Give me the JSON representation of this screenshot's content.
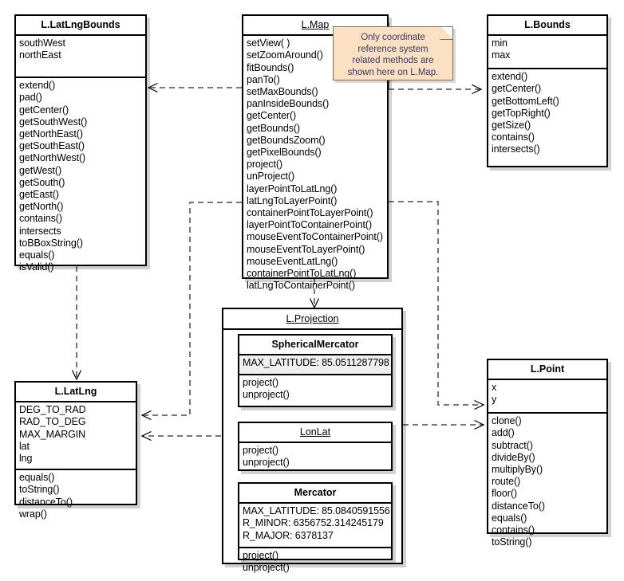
{
  "diagram": {
    "kind": "uml-class-diagram",
    "note": {
      "lines": [
        "Only coordinate",
        "reference system",
        "related methods are",
        "shown here on L.Map."
      ],
      "fill_color": "#fbe0c4",
      "text_color": "#3a3a5a"
    },
    "classes": {
      "latlngbounds": {
        "name": "L.LatLngBounds",
        "underlined": false,
        "attributes": [
          "southWest",
          "northEast"
        ],
        "methods": [
          "extend()",
          "pad()",
          "getCenter()",
          "getSouthWest()",
          "getNorthEast()",
          "getSouthEast()",
          "getNorthWest()",
          "getWest()",
          "getSouth()",
          "getEast()",
          "getNorth()",
          "contains()",
          "intersects",
          "toBBoxString()",
          "equals()",
          "isValid()"
        ]
      },
      "map": {
        "name": "L.Map",
        "underlined": true,
        "attributes": [],
        "methods": [
          "setView( )",
          "setZoomAround()",
          "fitBounds()",
          "panTo()",
          "setMaxBounds()",
          "panInsideBounds()",
          "getCenter()",
          "getBounds()",
          "getBoundsZoom()",
          "getPixelBounds()",
          "project()",
          "unProject()",
          "layerPointToLatLng()",
          "latLngToLayerPoint()",
          "containerPointToLayerPoint()",
          "layerPointToContainerPoint()",
          "mouseEventToContainerPoint()",
          "mouseEventToLayerPoint()",
          "mouseEventLatLng()",
          "containerPointToLatLng()",
          "latLngToContainerPoint()"
        ]
      },
      "bounds": {
        "name": "L.Bounds",
        "underlined": false,
        "attributes": [
          "min",
          "max"
        ],
        "methods": [
          "extend()",
          "getCenter()",
          "getBottomLeft()",
          "getTopRight()",
          "getSize()",
          "contains()",
          "intersects()"
        ]
      },
      "latlng": {
        "name": "L.LatLng",
        "underlined": false,
        "attributes": [
          "DEG_TO_RAD",
          "RAD_TO_DEG",
          "MAX_MARGIN",
          "lat",
          "lng"
        ],
        "methods": [
          "equals()",
          "toString()",
          "distanceTo()",
          "wrap()"
        ]
      },
      "point": {
        "name": "L.Point",
        "underlined": false,
        "attributes": [
          "x",
          "y"
        ],
        "methods": [
          "clone()",
          "add()",
          "subtract()",
          "divideBy()",
          "multiplyBy()",
          "route()",
          "floor()",
          "distanceTo()",
          "equals()",
          "contains()",
          "toString()"
        ]
      },
      "projection": {
        "name": "L.Projection",
        "underlined": true
      },
      "sphericalmercator": {
        "name": "SphericalMercator",
        "underlined": false,
        "attributes": [
          "MAX_LATITUDE: 85.0511287798"
        ],
        "methods": [
          "project()",
          "unproject()"
        ]
      },
      "lonlat": {
        "name": "LonLat",
        "underlined": true,
        "attributes": [],
        "methods": [
          "project()",
          "unproject()"
        ]
      },
      "mercator": {
        "name": "Mercator",
        "underlined": false,
        "attributes": [
          "MAX_LATITUDE: 85.0840591556",
          "R_MINOR: 6356752.314245179",
          "R_MAJOR: 6378137"
        ],
        "methods": [
          "project()",
          "unproject()"
        ]
      }
    },
    "relationships": [
      {
        "from": "L.Map",
        "to": "L.LatLngBounds",
        "type": "dependency"
      },
      {
        "from": "L.Map",
        "to": "L.Bounds",
        "type": "dependency"
      },
      {
        "from": "L.Map",
        "to": "L.LatLng",
        "type": "dependency"
      },
      {
        "from": "L.Map",
        "to": "L.Point",
        "type": "dependency"
      },
      {
        "from": "L.Map",
        "to": "L.Projection",
        "type": "dependency"
      },
      {
        "from": "L.LatLngBounds",
        "to": "L.LatLng",
        "type": "dependency"
      },
      {
        "from": "L.Projection",
        "to": "L.LatLng",
        "type": "dependency"
      },
      {
        "from": "L.Projection",
        "to": "L.Point",
        "type": "dependency"
      }
    ]
  }
}
